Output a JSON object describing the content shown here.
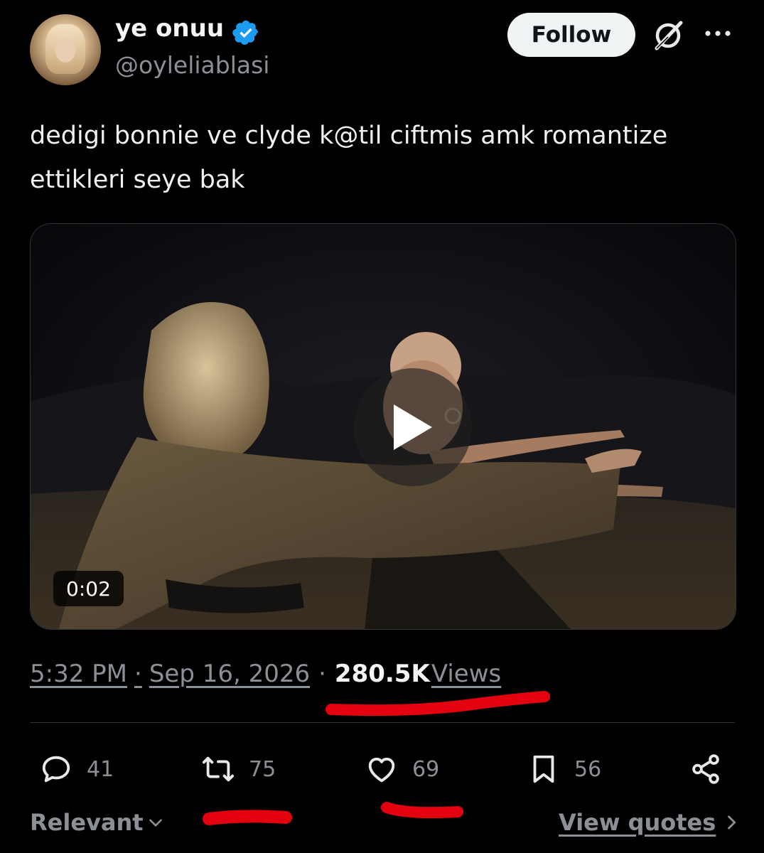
{
  "author": {
    "display_name": "ye onuu",
    "handle": "@oyleliablasi",
    "verified": true,
    "avatar_icon": "avatar-photo"
  },
  "header": {
    "follow_label": "Follow",
    "grok_icon": "grok-icon",
    "more_icon": "more-options-icon"
  },
  "tweet": {
    "text": "dedigi bonnie ve clyde k@til ciftmis amk romantize ettikleri seye bak"
  },
  "media": {
    "type": "video",
    "duration": "0:02",
    "play_icon": "play-icon"
  },
  "meta": {
    "time": "5:32 PM",
    "separator": "·",
    "date": "Sep 16, 2026",
    "views_count": "280.5K",
    "views_label": "Views"
  },
  "actions": {
    "replies": "41",
    "reposts": "75",
    "likes": "69",
    "bookmarks": "56"
  },
  "footer": {
    "sort_label": "Relevant",
    "view_quotes_label": "View quotes"
  },
  "colors": {
    "background": "#000000",
    "text_primary": "#e7e9ea",
    "text_secondary": "#8b9096",
    "verified_blue": "#1d9bf0",
    "annotation_red": "#e3000f",
    "divider": "#2f3336"
  }
}
